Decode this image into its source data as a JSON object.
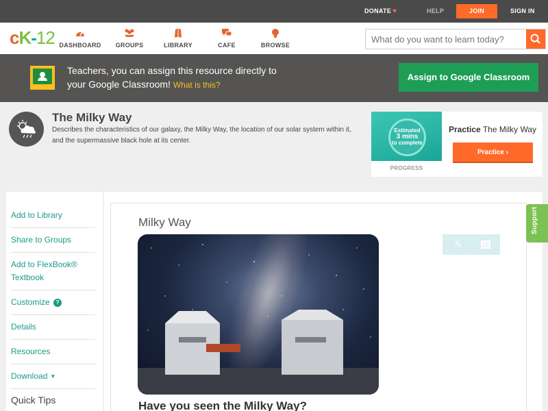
{
  "topbar": {
    "donate": "DONATE",
    "help": "HELP",
    "join": "JOIN",
    "signin": "SIGN IN"
  },
  "nav": {
    "logo": {
      "c": "c",
      "k": "K",
      "dash": "-",
      "num": "12"
    },
    "items": [
      {
        "label": "DASHBOARD",
        "icon": "dashboard-gauge-icon"
      },
      {
        "label": "GROUPS",
        "icon": "groups-icon"
      },
      {
        "label": "LIBRARY",
        "icon": "library-book-icon"
      },
      {
        "label": "CAFE",
        "icon": "cafe-chat-icon"
      },
      {
        "label": "BROWSE",
        "icon": "browse-bulb-icon"
      }
    ],
    "search_placeholder": "What do you want to learn today?"
  },
  "banner": {
    "line1": "Teachers, you can assign this resource directly to",
    "line2": "your Google Classroom!",
    "what": "What is this?",
    "button": "Assign to Google Classroom"
  },
  "concept": {
    "title": "The Milky Way",
    "description": "Describes the characteristics of our galaxy, the Milky Way, the location of our solar system within it, and the supermassive black hole at its center."
  },
  "practice": {
    "estimated": "Estimated",
    "mins": "3 mins",
    "to_complete": "to complete",
    "progress_label": "PROGRESS",
    "title_bold": "Practice",
    "title_rest": "The Milky Way",
    "button": "Practice"
  },
  "sidebar": {
    "items": [
      {
        "label": "Add to Library"
      },
      {
        "label": "Share to Groups"
      },
      {
        "label": "Add to FlexBook® Textbook"
      },
      {
        "label": "Customize"
      },
      {
        "label": "Details"
      },
      {
        "label": "Resources"
      },
      {
        "label": "Download"
      }
    ],
    "quick_tips": "Quick Tips"
  },
  "content": {
    "title": "Milky Way",
    "heading": "Have you seen the Milky Way?"
  },
  "support": "Support",
  "colors": {
    "accent_orange": "#ff6a2a",
    "accent_green": "#1e9e55",
    "link_teal": "#1a9a86",
    "topbar": "#4a4a4a"
  }
}
